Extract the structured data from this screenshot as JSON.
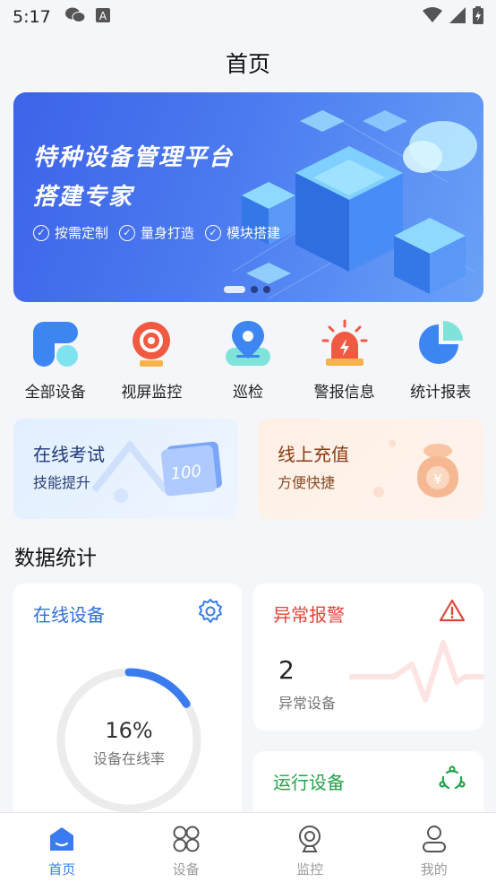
{
  "status_bar": {
    "time": "5:17",
    "icons": [
      "wechat-icon",
      "text-icon",
      "wifi-icon",
      "signal-icon",
      "battery-icon"
    ]
  },
  "page_title": "首页",
  "banner": {
    "title_line1": "特种设备管理平台",
    "title_line2": "搭建专家",
    "tags": [
      "按需定制",
      "量身打造",
      "模块搭建"
    ],
    "pages": 3,
    "active_page": 1
  },
  "quick_actions": [
    {
      "label": "全部设备",
      "icon": "all-devices-icon"
    },
    {
      "label": "视屏监控",
      "icon": "camera-icon"
    },
    {
      "label": "巡检",
      "icon": "location-pin-icon"
    },
    {
      "label": "警报信息",
      "icon": "alarm-siren-icon"
    },
    {
      "label": "统计报表",
      "icon": "pie-chart-icon"
    }
  ],
  "promos": {
    "exam": {
      "title": "在线考试",
      "subtitle": "技能提升"
    },
    "recharge": {
      "title": "线上充值",
      "subtitle": "方便快捷"
    }
  },
  "stats_title": "数据统计",
  "online_card": {
    "title": "在线设备",
    "percent_text": "16%",
    "percent": 0.16,
    "label": "设备在线率"
  },
  "alarm_card": {
    "title": "异常报警",
    "count": "2",
    "label": "异常设备"
  },
  "running_card": {
    "title": "运行设备"
  },
  "tabs": [
    {
      "label": "首页",
      "icon": "home-icon",
      "active": true
    },
    {
      "label": "设备",
      "icon": "devices-icon",
      "active": false
    },
    {
      "label": "监控",
      "icon": "webcam-icon",
      "active": false
    },
    {
      "label": "我的",
      "icon": "user-icon",
      "active": false
    }
  ],
  "colors": {
    "primary": "#3a7cf0",
    "alarm": "#e0453a",
    "running": "#25a34a"
  }
}
